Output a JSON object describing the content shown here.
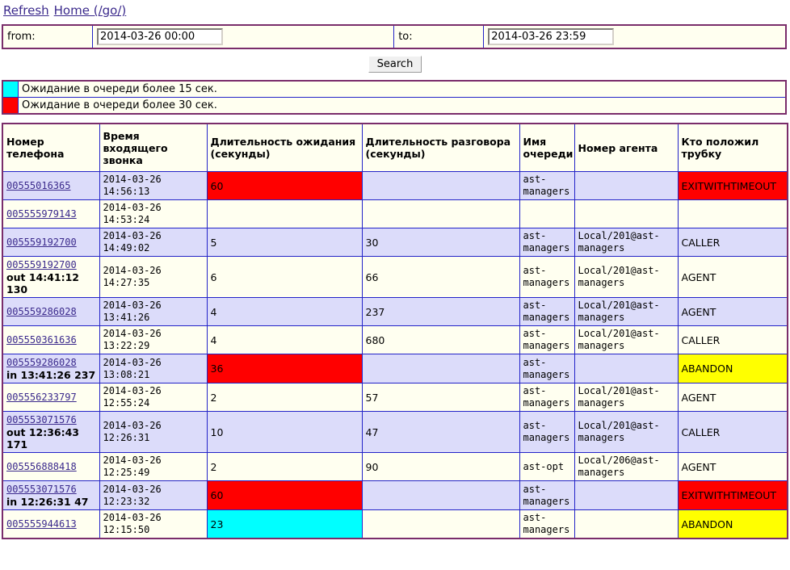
{
  "topnav": {
    "refresh_label": "Refresh",
    "home_label": "Home (/go/)"
  },
  "search_form": {
    "from_label": "from:",
    "from_value": "2014-03-26 00:00",
    "to_label": "to:",
    "to_value": "2014-03-26 23:59",
    "search_button": "Search"
  },
  "legend": [
    {
      "color": "#00FFFF",
      "text": "Ожидание в очереди более 15 сек."
    },
    {
      "color": "#FF0000",
      "text": "Ожидание в очереди более 30 сек."
    }
  ],
  "table": {
    "headers": [
      "Номер телефона",
      "Время входящего звонка",
      "Длительность ожидания (секунды)",
      "Длительность разговора (секунды)",
      "Имя очереди",
      "Номер агента",
      "Кто положил трубку"
    ],
    "rows": [
      {
        "phone": "00555016365",
        "extra": "",
        "time": "2014-03-26 14:56:13",
        "wait": "60",
        "wait_hl": "red",
        "talk": "",
        "talk_hl": "",
        "queue": "ast-managers",
        "agent": "",
        "hangup": "EXITWITHTIMEOUT",
        "hangup_hl": "red"
      },
      {
        "phone": "005555979143",
        "extra": "",
        "time": "2014-03-26 14:53:24",
        "wait": "",
        "wait_hl": "",
        "talk": "",
        "talk_hl": "",
        "queue": "",
        "agent": "",
        "hangup": "",
        "hangup_hl": ""
      },
      {
        "phone": "005559192700",
        "extra": "",
        "time": "2014-03-26 14:49:02",
        "wait": "5",
        "wait_hl": "",
        "talk": "30",
        "talk_hl": "",
        "queue": "ast-managers",
        "agent": "Local/201@ast-managers",
        "hangup": "CALLER",
        "hangup_hl": ""
      },
      {
        "phone": "005559192700",
        "extra": "out 14:41:12 130",
        "time": "2014-03-26 14:27:35",
        "wait": "6",
        "wait_hl": "",
        "talk": "66",
        "talk_hl": "",
        "queue": "ast-managers",
        "agent": "Local/201@ast-managers",
        "hangup": "AGENT",
        "hangup_hl": ""
      },
      {
        "phone": "005559286028",
        "extra": "",
        "time": "2014-03-26 13:41:26",
        "wait": "4",
        "wait_hl": "",
        "talk": "237",
        "talk_hl": "",
        "queue": "ast-managers",
        "agent": "Local/201@ast-managers",
        "hangup": "AGENT",
        "hangup_hl": ""
      },
      {
        "phone": "005550361636",
        "extra": "",
        "time": "2014-03-26 13:22:29",
        "wait": "4",
        "wait_hl": "",
        "talk": "680",
        "talk_hl": "",
        "queue": "ast-managers",
        "agent": "Local/201@ast-managers",
        "hangup": "CALLER",
        "hangup_hl": ""
      },
      {
        "phone": "005559286028",
        "extra": "in 13:41:26 237",
        "time": "2014-03-26 13:08:21",
        "wait": "36",
        "wait_hl": "red",
        "talk": "",
        "talk_hl": "",
        "queue": "ast-managers",
        "agent": "",
        "hangup": "ABANDON",
        "hangup_hl": "yellow"
      },
      {
        "phone": "005556233797",
        "extra": "",
        "time": "2014-03-26 12:55:24",
        "wait": "2",
        "wait_hl": "",
        "talk": "57",
        "talk_hl": "",
        "queue": "ast-managers",
        "agent": "Local/201@ast-managers",
        "hangup": "AGENT",
        "hangup_hl": ""
      },
      {
        "phone": "005553071576",
        "extra": "out 12:36:43 171",
        "time": "2014-03-26 12:26:31",
        "wait": "10",
        "wait_hl": "",
        "talk": "47",
        "talk_hl": "",
        "queue": "ast-managers",
        "agent": "Local/201@ast-managers",
        "hangup": "CALLER",
        "hangup_hl": ""
      },
      {
        "phone": "005556888418",
        "extra": "",
        "time": "2014-03-26 12:25:49",
        "wait": "2",
        "wait_hl": "",
        "talk": "90",
        "talk_hl": "",
        "queue": "ast-opt",
        "agent": "Local/206@ast-managers",
        "hangup": "AGENT",
        "hangup_hl": ""
      },
      {
        "phone": "005553071576",
        "extra": "in 12:26:31 47",
        "time": "2014-03-26 12:23:32",
        "wait": "60",
        "wait_hl": "red",
        "talk": "",
        "talk_hl": "",
        "queue": "ast-managers",
        "agent": "",
        "hangup": "EXITWITHTIMEOUT",
        "hangup_hl": "red"
      },
      {
        "phone": "005555944613",
        "extra": "",
        "time": "2014-03-26 12:15:50",
        "wait": "23",
        "wait_hl": "cyan",
        "talk": "",
        "talk_hl": "",
        "queue": "ast-managers",
        "agent": "",
        "hangup": "ABANDON",
        "hangup_hl": "yellow"
      }
    ]
  }
}
